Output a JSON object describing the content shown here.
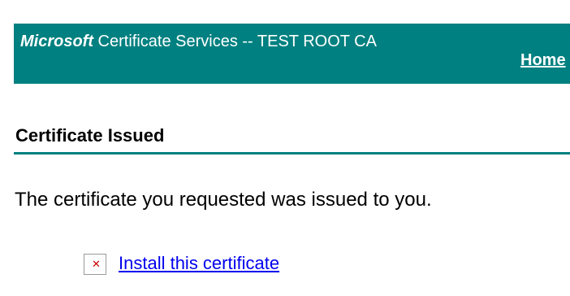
{
  "header": {
    "brand": "Microsoft",
    "title_rest": " Certificate Services  --  TEST ROOT CA",
    "home_label": "Home",
    "background_color": "#008080"
  },
  "section": {
    "title": "Certificate Issued"
  },
  "body": {
    "message": "The certificate you requested was issued to you.",
    "install_link": "Install this certificate",
    "install_icon": "broken-image-icon"
  },
  "colors": {
    "link": "#0000ee",
    "accent": "#008080"
  }
}
